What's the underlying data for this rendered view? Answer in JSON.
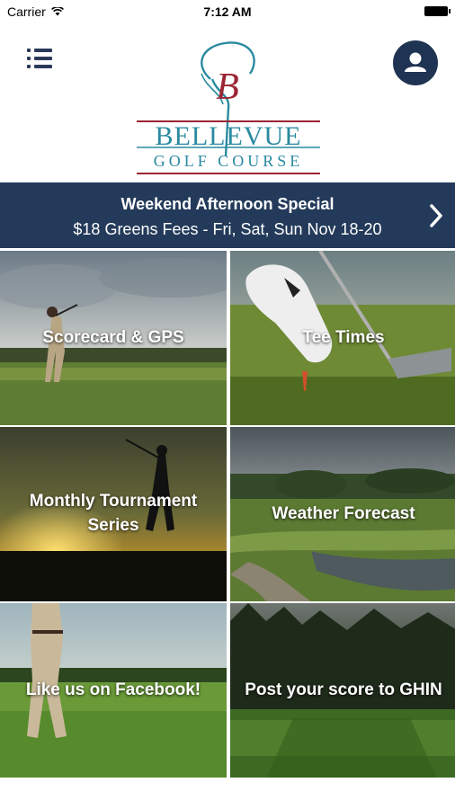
{
  "status_bar": {
    "carrier": "Carrier",
    "time": "7:12 AM"
  },
  "header": {
    "logo": {
      "monogram": "B",
      "name": "BELLEVUE",
      "tagline": "GOLF COURSE"
    }
  },
  "banner": {
    "title": "Weekend Afternoon Special",
    "subtitle": "$18 Greens Fees - Fri, Sat, Sun Nov 18-20"
  },
  "tiles": [
    {
      "label": "Scorecard & GPS"
    },
    {
      "label": "Tee Times"
    },
    {
      "label": "Monthly Tournament\nSeries"
    },
    {
      "label": "Weather Forecast"
    },
    {
      "label": "Like us on Facebook!"
    },
    {
      "label": "Post your score to GHIN"
    }
  ],
  "colors": {
    "navy": "#233a5a",
    "logo_red": "#9b2535",
    "logo_teal": "#2a8aa0"
  }
}
